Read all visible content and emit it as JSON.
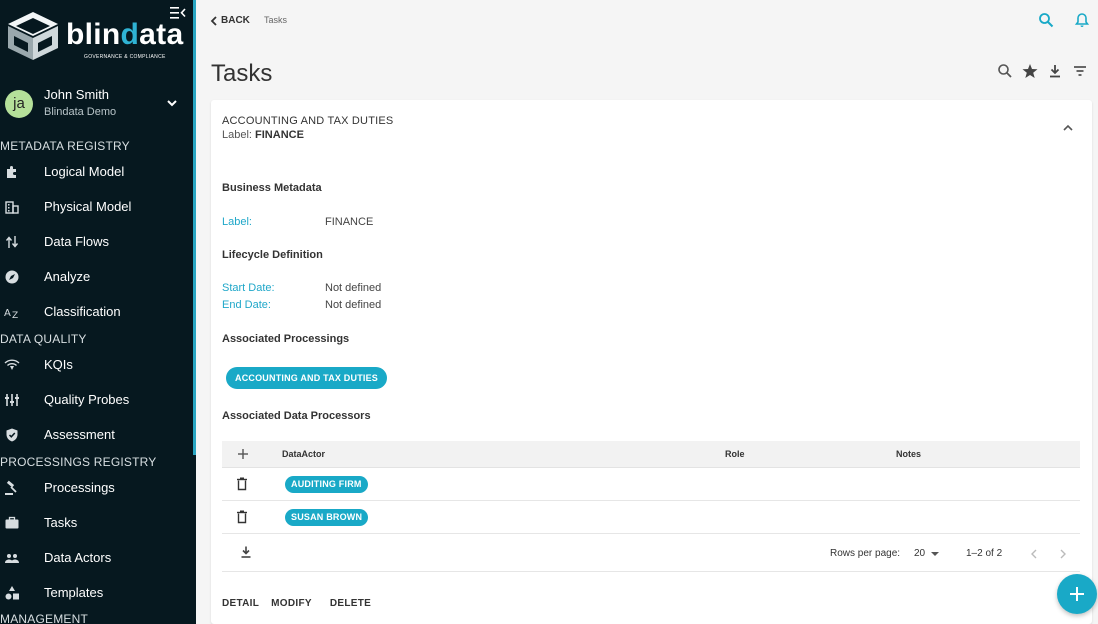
{
  "sidebar": {
    "logo": {
      "name_pre": "blin",
      "name_acc": "d",
      "name_post": "ata",
      "tagline": "GOVERNANCE & COMPLIANCE"
    },
    "user": {
      "initials": "ja",
      "name": "John Smith",
      "org": "Blindata Demo"
    },
    "sections": {
      "metadata": "METADATA REGISTRY",
      "quality": "DATA QUALITY",
      "processings": "PROCESSINGS REGISTRY",
      "management": "MANAGEMENT"
    },
    "items": {
      "logical_model": "Logical Model",
      "physical_model": "Physical Model",
      "data_flows": "Data Flows",
      "analyze": "Analyze",
      "classification": "Classification",
      "kqis": "KQIs",
      "quality_probes": "Quality Probes",
      "assessment": "Assessment",
      "processings": "Processings",
      "tasks": "Tasks",
      "data_actors": "Data Actors",
      "templates": "Templates"
    }
  },
  "topbar": {
    "back": "BACK",
    "crumb": "Tasks"
  },
  "page": {
    "title": "Tasks"
  },
  "card": {
    "title": "ACCOUNTING AND TAX DUTIES",
    "label_prefix": "Label: ",
    "label_value": "FINANCE",
    "business_metadata": "Business Metadata",
    "label_key": "Label:",
    "label_val": "FINANCE",
    "lifecycle": "Lifecycle Definition",
    "start_key": "Start Date:",
    "start_val": "Not defined",
    "end_key": "End Date:",
    "end_val": "Not defined",
    "assoc_processings": "Associated Processings",
    "processing_chip": "ACCOUNTING AND TAX DUTIES",
    "assoc_processors": "Associated Data Processors",
    "table": {
      "columns": [
        "DataActor",
        "Role",
        "Notes"
      ],
      "rows": [
        {
          "actor": "AUDITING FIRM",
          "role": "",
          "notes": ""
        },
        {
          "actor": "SUSAN BROWN",
          "role": "",
          "notes": ""
        }
      ],
      "rows_per_page_label": "Rows per page:",
      "rows_per_page": "20",
      "range": "1–2 of 2"
    },
    "actions": {
      "detail": "DETAIL",
      "modify": "MODIFY",
      "delete": "DELETE"
    }
  },
  "colors": {
    "accent": "#19a9c7",
    "sidebar_bg": "#06181f"
  }
}
